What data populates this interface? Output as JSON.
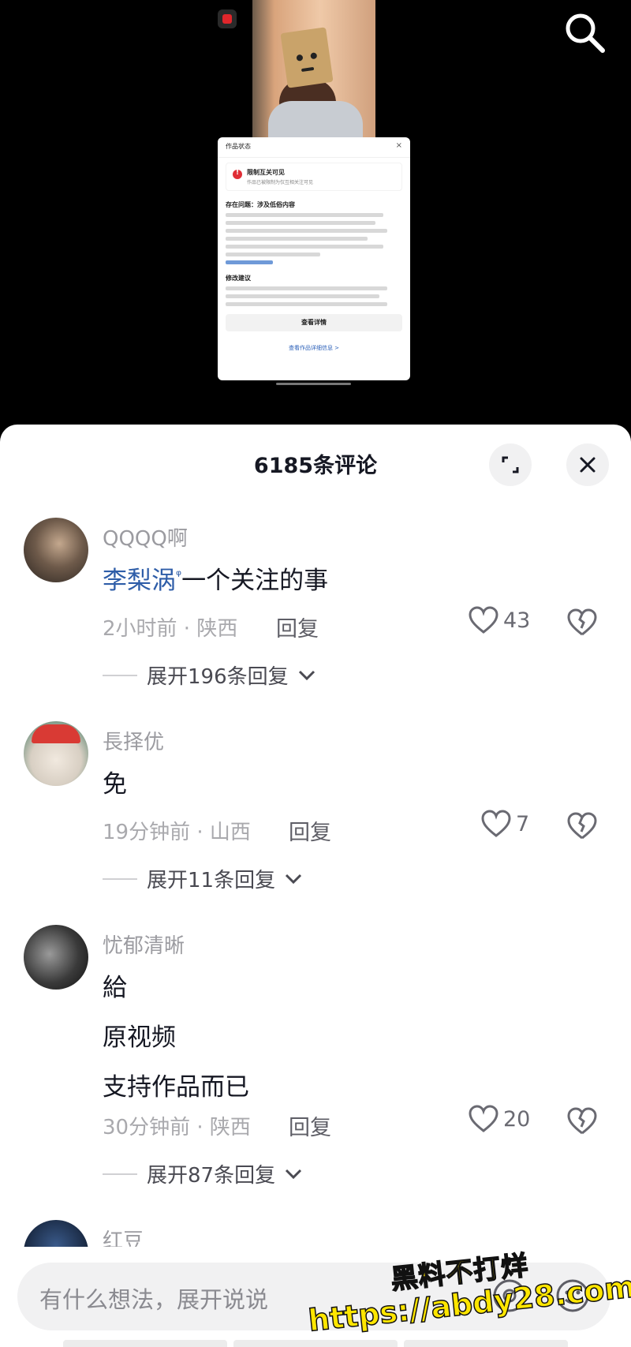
{
  "video": {
    "status_card": {
      "title": "作品状态",
      "close": "×",
      "warning_title": "限制互关可见",
      "warning_sub": "作品已被限制为仅互相关注可见",
      "issue_title": "存在问题：涉及低俗内容",
      "suggestion_title": "修改建议",
      "more_link": "查看规则",
      "view_button": "查看详情",
      "footer_link": "查看作品详细信息 >"
    }
  },
  "comments_header": {
    "title": "6185条评论"
  },
  "comments": [
    {
      "username": "QQQQ啊",
      "mention": "李梨涡",
      "text": "一个关注的事",
      "meta": "2小时前 · 陕西",
      "reply": "回复",
      "likes": "43",
      "expand": "展开196条回复"
    },
    {
      "username": "長择优",
      "text": "免",
      "meta": "19分钟前 · 山西",
      "reply": "回复",
      "likes": "7",
      "expand": "展开11条回复"
    },
    {
      "username": "忧郁清晰",
      "lines": [
        "給",
        "原视频",
        "支持作品而已"
      ],
      "meta": "30分钟前 · 陕西",
      "reply": "回复",
      "likes": "20",
      "expand": "展开87条回复"
    },
    {
      "username": "红豆"
    }
  ],
  "input": {
    "placeholder": "有什么想法，展开说说"
  },
  "watermark": {
    "line1": "黑料不打烊",
    "line2": "https://abdy28.com"
  },
  "colors": {
    "accent_link": "#2e5da8",
    "sheet_bg": "#ffffff",
    "watermark": "#ffe600"
  }
}
